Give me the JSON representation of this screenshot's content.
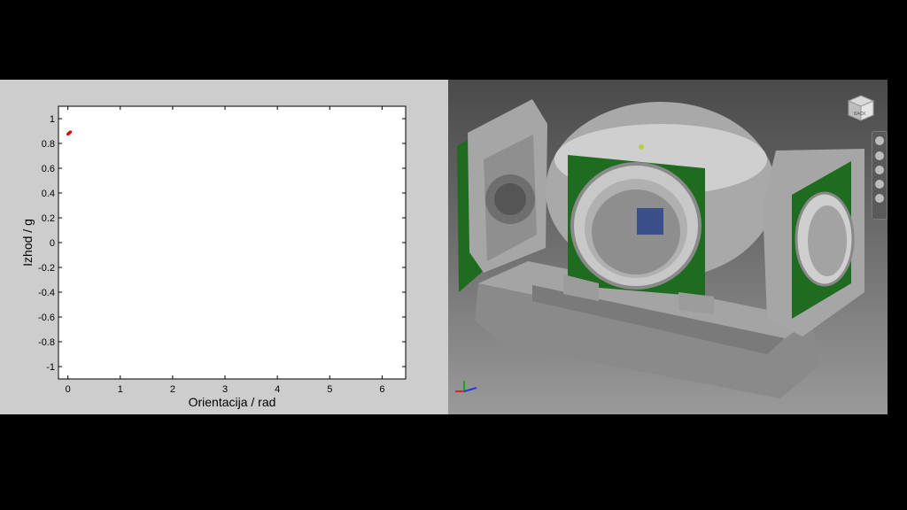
{
  "plot": {
    "chart_data": {
      "type": "scatter",
      "xlabel": "Orientacija / rad",
      "ylabel": "Izhod / g",
      "xlim": [
        -0.18,
        6.45
      ],
      "ylim": [
        -1.1,
        1.1
      ],
      "xticks": [
        "0",
        "1",
        "2",
        "3",
        "4",
        "5",
        "6"
      ],
      "xtick_values": [
        0,
        1,
        2,
        3,
        4,
        5,
        6
      ],
      "yticks": [
        "1",
        "0.8",
        "0.6",
        "0.4",
        "0.2",
        "0",
        "-0.2",
        "-0.4",
        "-0.6",
        "-0.8",
        "-1"
      ],
      "ytick_values": [
        1,
        0.8,
        0.6,
        0.4,
        0.2,
        0,
        -0.2,
        -0.4,
        -0.6,
        -0.8,
        -1
      ],
      "grid": false,
      "series": [
        {
          "color": "#e00000",
          "x": [
            0.0,
            0.01,
            0.02,
            0.03,
            0.04,
            0.05
          ],
          "y": [
            0.875,
            0.879,
            0.883,
            0.886,
            0.89,
            0.893
          ]
        }
      ]
    }
  },
  "cad": {
    "view_cube_label": "BACK",
    "colors": {
      "frame": "#9e9e9e",
      "pcb": "#1f6b1f",
      "bearing": "#cfcfcf"
    },
    "nav_icons": [
      "steering-wheel-icon",
      "pan-icon",
      "zoom-icon",
      "orbit-icon",
      "look-at-icon"
    ]
  }
}
